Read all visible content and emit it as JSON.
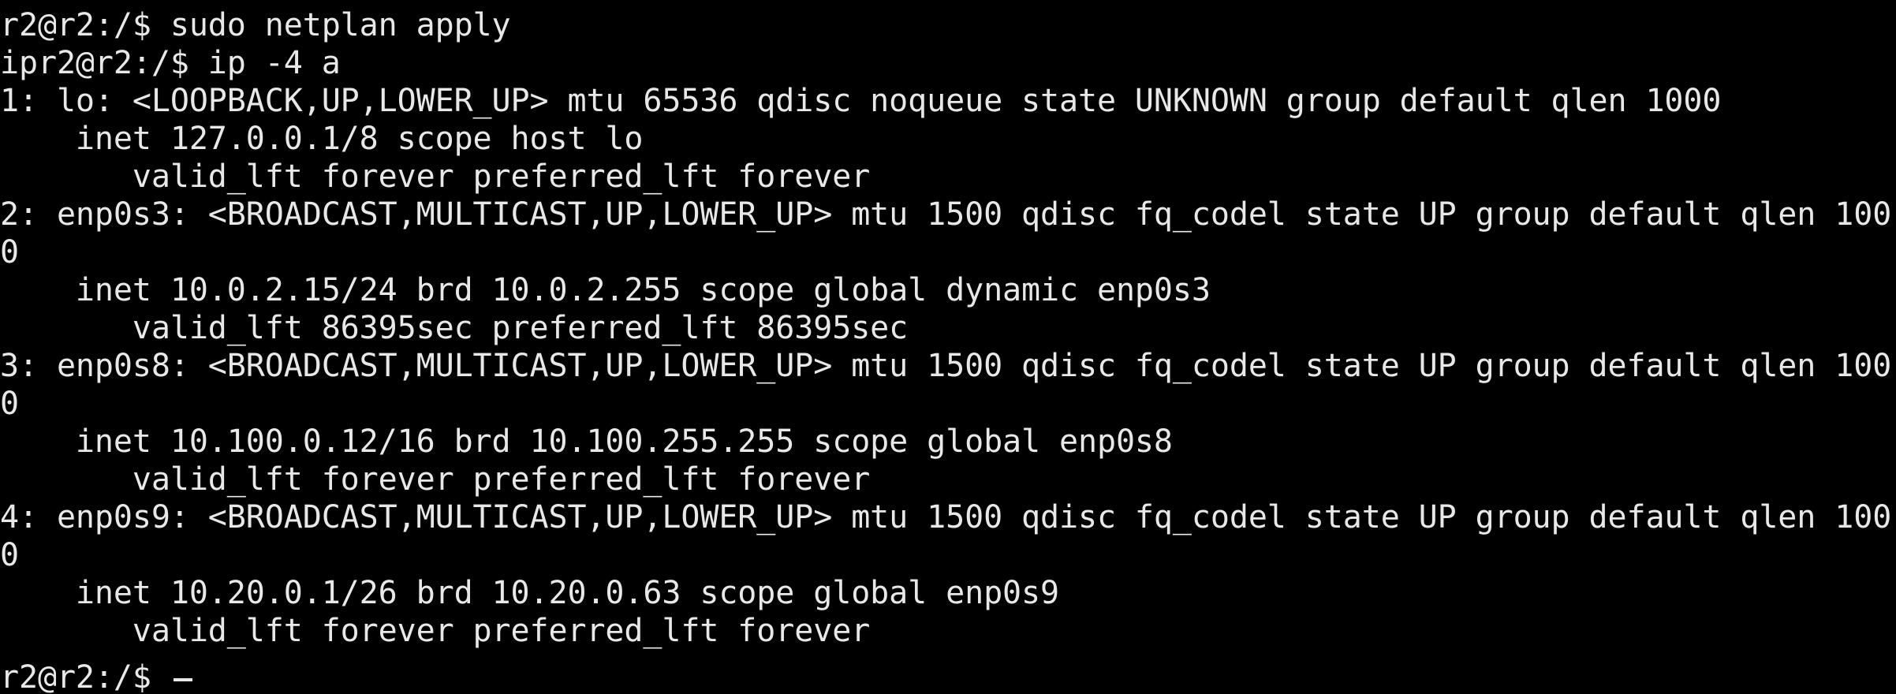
{
  "terminal": {
    "background": "#000000",
    "foreground": "#e8e8e8",
    "lines": [
      "r2@r2:/$ sudo netplan apply",
      "ipr2@r2:/$ ip -4 a",
      "1: lo: <LOOPBACK,UP,LOWER_UP> mtu 65536 qdisc noqueue state UNKNOWN group default qlen 1000",
      "    inet 127.0.0.1/8 scope host lo",
      "       valid_lft forever preferred_lft forever",
      "2: enp0s3: <BROADCAST,MULTICAST,UP,LOWER_UP> mtu 1500 qdisc fq_codel state UP group default qlen 100",
      "0",
      "    inet 10.0.2.15/24 brd 10.0.2.255 scope global dynamic enp0s3",
      "       valid_lft 86395sec preferred_lft 86395sec",
      "3: enp0s8: <BROADCAST,MULTICAST,UP,LOWER_UP> mtu 1500 qdisc fq_codel state UP group default qlen 100",
      "0",
      "    inet 10.100.0.12/16 brd 10.100.255.255 scope global enp0s8",
      "       valid_lft forever preferred_lft forever",
      "4: enp0s9: <BROADCAST,MULTICAST,UP,LOWER_UP> mtu 1500 qdisc fq_codel state UP group default qlen 100",
      "0",
      "    inet 10.20.0.1/26 brd 10.20.0.63 scope global enp0s9",
      "       valid_lft forever preferred_lft forever"
    ],
    "prompt": "r2@r2:/$ "
  }
}
